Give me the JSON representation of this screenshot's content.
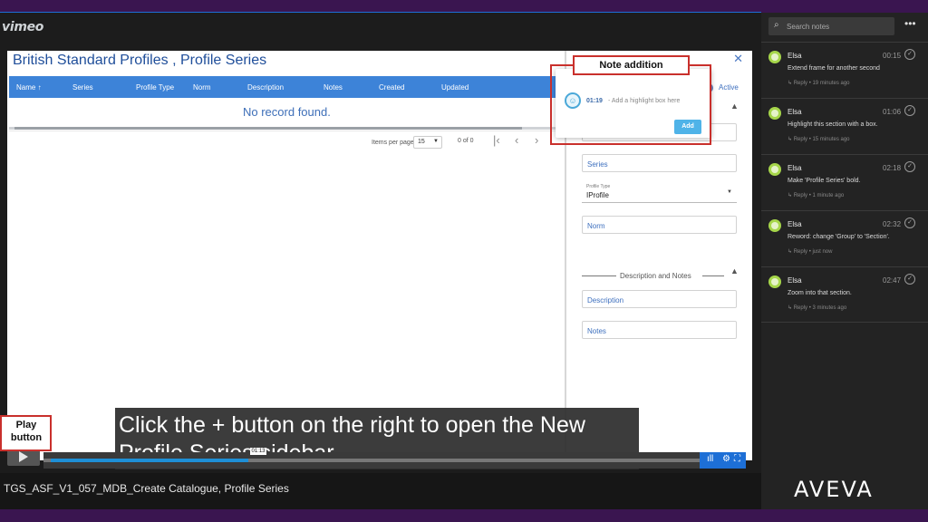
{
  "player": {
    "brand": "vimeo",
    "video_title": "TGS_ASF_V1_057_MDB_Create Catalogue, Profile Series",
    "current_time": "01:13",
    "progress": 0.3
  },
  "app": {
    "title": "British Standard Profiles , Profile Series",
    "columns": [
      "Name",
      "Series",
      "Profile Type",
      "Norm",
      "Description",
      "Notes",
      "Created",
      "Updated"
    ],
    "empty_text": "No record found.",
    "pager": {
      "items_label": "Items per page",
      "per_page": "15",
      "range": "0 of 0",
      "first_icon": "|‹",
      "prev_icon": "‹",
      "next_icon": "›"
    }
  },
  "side_form": {
    "active_label": "Active",
    "fields": [
      "Series",
      "Norm"
    ],
    "profile_type_label": "Profile Type",
    "profile_type_value": "IProfile",
    "desc_section_title": "Description and Notes",
    "desc_fields": [
      "Description",
      "Notes"
    ]
  },
  "note_popup": {
    "time": "01:19",
    "input_value": "- Add a highlight box here",
    "add_label": "Add"
  },
  "callouts": {
    "note_addition": "Note addition",
    "play_button": "Play button"
  },
  "caption": "Click the + button on the right to open the New Profile Series sidebar.",
  "notes_panel": {
    "search_placeholder": "Search notes",
    "notes": [
      {
        "author": "Elsa",
        "time": "00:15",
        "text": "Extend frame for another second",
        "reply": "↳ Reply • 19 minutes ago"
      },
      {
        "author": "Elsa",
        "time": "01:06",
        "text": "Highlight this section with a box.",
        "reply": "↳ Reply • 15 minutes ago"
      },
      {
        "author": "Elsa",
        "time": "02:18",
        "text": "Make 'Profile Series' bold.",
        "reply": "↳ Reply • 1 minute ago"
      },
      {
        "author": "Elsa",
        "time": "02:32",
        "text": "Reword: change 'Group' to 'Section'.",
        "reply": "↳ Reply • just now"
      },
      {
        "author": "Elsa",
        "time": "02:47",
        "text": "Zoom into that section.",
        "reply": "↳ Reply • 3 minutes ago"
      }
    ]
  },
  "brand_logo": "AVEVA"
}
